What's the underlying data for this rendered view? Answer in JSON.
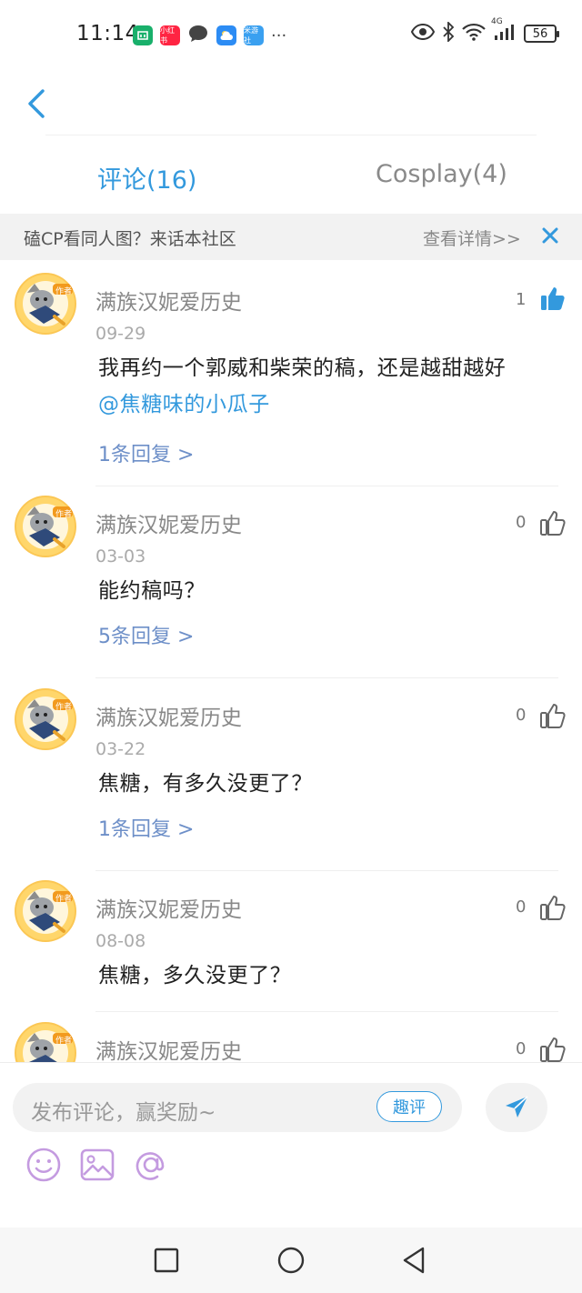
{
  "status_bar": {
    "time": "11:14",
    "app_icons": [
      {
        "name": "mi-home-icon",
        "color": "#19b06b",
        "glyph": "米"
      },
      {
        "name": "xiaohongshu-icon",
        "color": "#ff2442",
        "glyph": "小红书"
      },
      {
        "name": "message-icon",
        "color": "#444444",
        "glyph": ""
      },
      {
        "name": "weather-icon",
        "color": "#2c8cf4",
        "glyph": ""
      },
      {
        "name": "app-icon",
        "color": "#3aa0f0",
        "glyph": "米游社"
      }
    ],
    "overflow": "···",
    "network": "4G",
    "battery": "56"
  },
  "header": {
    "back_icon": "back-arrow-icon",
    "tabs": [
      {
        "label": "评论(16)",
        "active": true
      },
      {
        "label": "Cosplay(4)",
        "active": false
      }
    ]
  },
  "banner": {
    "text": "磕CP看同人图？来话本社区",
    "link": "查看详情>>",
    "close_icon": "close-icon"
  },
  "comments": [
    {
      "user": "满族汉妮爱历史",
      "date": "09-29",
      "text": "我再约一个郭威和柴荣的稿，还是越甜越好",
      "mention": "@焦糖味的小瓜子",
      "replies": "1条回复 >",
      "likes": "1",
      "liked": true
    },
    {
      "user": "满族汉妮爱历史",
      "date": "03-03",
      "text": "能约稿吗？",
      "mention": "",
      "replies": "5条回复 >",
      "likes": "0",
      "liked": false
    },
    {
      "user": "满族汉妮爱历史",
      "date": "03-22",
      "text": "焦糖，有多久没更了？",
      "mention": "",
      "replies": "1条回复 >",
      "likes": "0",
      "liked": false
    },
    {
      "user": "满族汉妮爱历史",
      "date": "08-08",
      "text": "焦糖，多久没更了？",
      "mention": "",
      "replies": "",
      "likes": "0",
      "liked": false
    },
    {
      "user": "满族汉妮爱历史",
      "date": "",
      "text": "",
      "mention": "",
      "replies": "",
      "likes": "0",
      "liked": false
    }
  ],
  "avatar_badge": "作者",
  "composer": {
    "placeholder": "发布评论，赢奖励~",
    "qupin_label": "趣评",
    "tools": [
      "emoji-icon",
      "image-icon",
      "at-icon"
    ]
  },
  "colors": {
    "accent": "#3399dd",
    "reply_link": "#6d8fc8"
  }
}
